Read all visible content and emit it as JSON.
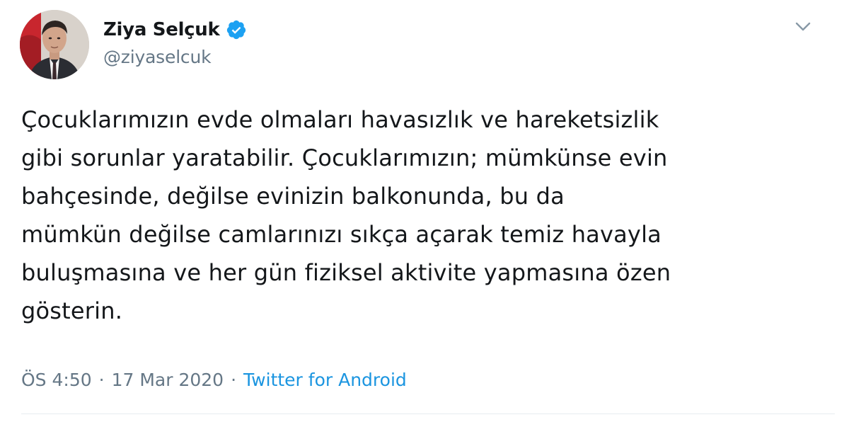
{
  "author": {
    "display_name": "Ziya Selçuk",
    "handle": "@ziyaselcuk",
    "verified": true,
    "verified_icon": "verified-badge-icon",
    "verified_color": "#1da1f2",
    "avatar_icon": "profile-photo"
  },
  "menu": {
    "icon": "chevron-down-icon"
  },
  "tweet": {
    "lines": [
      "Çocuklarımızın evde olmaları havasızlık ve hareketsizlik",
      "gibi sorunlar yaratabilir. Çocuklarımızın; mümkünse evin",
      "bahçesinde, değilse evinizin balkonunda, bu da",
      "mümkün değilse camlarınızı sıkça açarak temiz havayla",
      "buluşmasına ve her gün fiziksel aktivite yapmasına özen",
      "gösterin."
    ]
  },
  "meta": {
    "time": "ÖS 4:50",
    "separator": "·",
    "date": "17 Mar 2020",
    "source": "Twitter for Android"
  },
  "colors": {
    "text": "#14171a",
    "secondary": "#657786",
    "link": "#1b95e0",
    "divider": "#e6ecf0"
  }
}
